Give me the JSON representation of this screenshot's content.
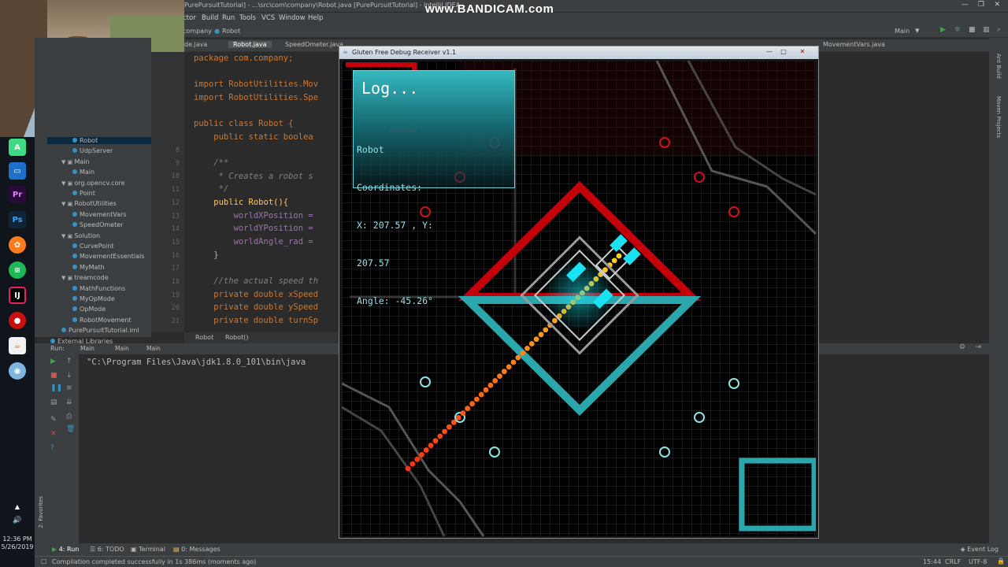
{
  "overlay": {
    "watermark": "www.BANDICAM.com"
  },
  "ide": {
    "window_title": "PurePursuitTutorial] - ...\\src\\com\\company\\Robot.java [PurePursuitTutorial] - IntelliJ IDEA",
    "menu": [
      "ctor",
      "Build",
      "Run",
      "Tools",
      "VCS",
      "Window",
      "Help"
    ],
    "nav": {
      "company": "company",
      "file": "Robot",
      "config": "Main"
    },
    "tabs": [
      "de.java",
      "Robot.java",
      "SpeedOmeter.java",
      "MovementVars.java"
    ],
    "tree": [
      {
        "label": "Robot",
        "indent": 2,
        "selected": true
      },
      {
        "label": "UdpServer",
        "indent": 2
      },
      {
        "label": "Main",
        "indent": 1,
        "folder": true
      },
      {
        "label": "Main",
        "indent": 2
      },
      {
        "label": "org.opencv.core",
        "indent": 1,
        "folder": true
      },
      {
        "label": "Point",
        "indent": 2
      },
      {
        "label": "RobotUtilities",
        "indent": 1,
        "folder": true
      },
      {
        "label": "MovementVars",
        "indent": 2
      },
      {
        "label": "SpeedOmeter",
        "indent": 2
      },
      {
        "label": "Solution",
        "indent": 1,
        "folder": true
      },
      {
        "label": "CurvePoint",
        "indent": 2
      },
      {
        "label": "MovementEssentials",
        "indent": 2
      },
      {
        "label": "MyMath",
        "indent": 2
      },
      {
        "label": "treamcode",
        "indent": 1,
        "folder": true
      },
      {
        "label": "MathFunctions",
        "indent": 2
      },
      {
        "label": "MyOpMode",
        "indent": 2
      },
      {
        "label": "OpMode",
        "indent": 2
      },
      {
        "label": "RobotMovement",
        "indent": 2
      },
      {
        "label": "PurePursuitTutorial.iml",
        "indent": 1
      },
      {
        "label": "External Libraries",
        "indent": 0
      }
    ],
    "line_numbers": [
      "8",
      "9",
      "10",
      "11",
      "12",
      "13",
      "14",
      "15",
      "16",
      "17",
      "18",
      "19",
      "20",
      "21"
    ],
    "code": {
      "l1": "package com.company;",
      "l2": "import RobotUtilities.Mov",
      "l3": "import RobotUtilities.Spe",
      "l4": "public class Robot {",
      "l5": "    public static boolea",
      "l6": "    /**",
      "l7": "     * Creates a robot s",
      "l8": "     */",
      "l9": "    public Robot(){",
      "l10": "        worldXPosition =",
      "l11": "        worldYPosition =",
      "l12": "        worldAngle_rad =",
      "l13": "    }",
      "l14": "    //the actual speed th",
      "l15": "    private double xSpeed",
      "l16": "    private double ySpeed",
      "l17": "    private double turnSp"
    },
    "breadcrumb": [
      "Robot",
      "Robot()"
    ],
    "run": {
      "label": "Run:",
      "tabs": [
        "Main",
        "Main",
        "Main"
      ],
      "output": "\"C:\\Program Files\\Java\\jdk1.8.0_101\\bin\\java"
    },
    "bottom_tools": [
      "4: Run",
      "6: TODO",
      "Terminal",
      "0: Messages"
    ],
    "event_log": "Event Log",
    "status": {
      "message": "Compilation completed successfully in 1s 386ms (moments ago)",
      "position": "15:44",
      "line_sep": "CRLF",
      "encoding": "UTF-8"
    },
    "right_tools": [
      "Ant Build",
      "Maven Projects"
    ],
    "left_tool": "2: Favorites"
  },
  "debug_window": {
    "title": "Gluten Free Debug Receiver v1.1",
    "log_title": "Log...",
    "log_lines": [
      "Robot",
      "Coordinates:",
      "X: 207.57 , Y:",
      "207.57",
      "Angle: -45.26°"
    ]
  },
  "taskbar": {
    "time": "12:36 PM",
    "date": "5/26/2019"
  },
  "colors": {
    "field_red": "#c4000a",
    "field_cyan": "#2aa6ad",
    "path_start": "#ff3010",
    "path_end": "#ffd21a",
    "robot_cyan": "#19e3f2"
  }
}
